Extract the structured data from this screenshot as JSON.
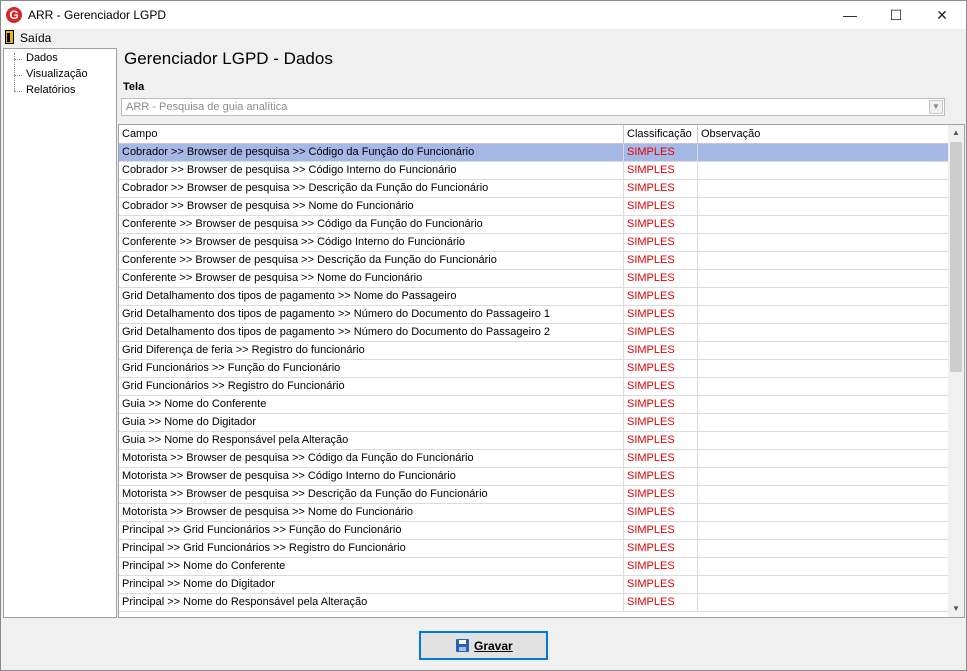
{
  "window": {
    "title": "ARR - Gerenciador LGPD",
    "icon_letter": "G",
    "controls": {
      "minimize": "—",
      "maximize": "☐",
      "close": "✕"
    }
  },
  "menu": {
    "exit_label": "Saída"
  },
  "tree": {
    "items": [
      "Dados",
      "Visualização",
      "Relatórios"
    ]
  },
  "page": {
    "title": "Gerenciador LGPD - Dados"
  },
  "tela": {
    "label": "Tela",
    "value": "ARR - Pesquisa de guia analítica"
  },
  "grid": {
    "columns": [
      "Campo",
      "Classificação",
      "Observação"
    ],
    "rows": [
      {
        "campo": "Cobrador >> Browser de pesquisa >> Código da Função do Funcionário",
        "classificacao": "SIMPLES",
        "observacao": ""
      },
      {
        "campo": "Cobrador >> Browser de pesquisa >> Código Interno do Funcionário",
        "classificacao": "SIMPLES",
        "observacao": ""
      },
      {
        "campo": "Cobrador >> Browser de pesquisa >> Descrição da Função do Funcionário",
        "classificacao": "SIMPLES",
        "observacao": ""
      },
      {
        "campo": "Cobrador >> Browser de pesquisa >> Nome do Funcionário",
        "classificacao": "SIMPLES",
        "observacao": ""
      },
      {
        "campo": "Conferente >> Browser de pesquisa >> Código da Função do Funcionário",
        "classificacao": "SIMPLES",
        "observacao": ""
      },
      {
        "campo": "Conferente >> Browser de pesquisa >> Código Interno do Funcionário",
        "classificacao": "SIMPLES",
        "observacao": ""
      },
      {
        "campo": "Conferente >> Browser de pesquisa >> Descrição da Função do Funcionário",
        "classificacao": "SIMPLES",
        "observacao": ""
      },
      {
        "campo": "Conferente >> Browser de pesquisa >> Nome do Funcionário",
        "classificacao": "SIMPLES",
        "observacao": ""
      },
      {
        "campo": "Grid Detalhamento dos tipos de pagamento >> Nome do Passageiro",
        "classificacao": "SIMPLES",
        "observacao": ""
      },
      {
        "campo": "Grid Detalhamento dos tipos de pagamento >> Número do Documento do Passageiro 1",
        "classificacao": "SIMPLES",
        "observacao": ""
      },
      {
        "campo": "Grid Detalhamento dos tipos de pagamento >> Número do Documento do Passageiro 2",
        "classificacao": "SIMPLES",
        "observacao": ""
      },
      {
        "campo": "Grid Diferença de feria >> Registro do funcionário",
        "classificacao": "SIMPLES",
        "observacao": ""
      },
      {
        "campo": "Grid Funcionários >> Função do Funcionário",
        "classificacao": "SIMPLES",
        "observacao": ""
      },
      {
        "campo": "Grid Funcionários >> Registro do Funcionário",
        "classificacao": "SIMPLES",
        "observacao": ""
      },
      {
        "campo": "Guia >> Nome do Conferente",
        "classificacao": "SIMPLES",
        "observacao": ""
      },
      {
        "campo": "Guia >> Nome do Digitador",
        "classificacao": "SIMPLES",
        "observacao": ""
      },
      {
        "campo": "Guia >> Nome do Responsável pela Alteração",
        "classificacao": "SIMPLES",
        "observacao": ""
      },
      {
        "campo": "Motorista >> Browser de pesquisa >> Código da Função do Funcionário",
        "classificacao": "SIMPLES",
        "observacao": ""
      },
      {
        "campo": "Motorista >> Browser de pesquisa >> Código Interno do Funcionário",
        "classificacao": "SIMPLES",
        "observacao": ""
      },
      {
        "campo": "Motorista >> Browser de pesquisa >> Descrição da Função do Funcionário",
        "classificacao": "SIMPLES",
        "observacao": ""
      },
      {
        "campo": "Motorista >> Browser de pesquisa >> Nome do Funcionário",
        "classificacao": "SIMPLES",
        "observacao": ""
      },
      {
        "campo": "Principal >> Grid Funcionários >> Função do Funcionário",
        "classificacao": "SIMPLES",
        "observacao": ""
      },
      {
        "campo": "Principal >> Grid Funcionários >> Registro do Funcionário",
        "classificacao": "SIMPLES",
        "observacao": ""
      },
      {
        "campo": "Principal >> Nome do Conferente",
        "classificacao": "SIMPLES",
        "observacao": ""
      },
      {
        "campo": "Principal >> Nome do Digitador",
        "classificacao": "SIMPLES",
        "observacao": ""
      },
      {
        "campo": "Principal >> Nome do Responsável pela Alteração",
        "classificacao": "SIMPLES",
        "observacao": ""
      }
    ],
    "selected_row": 0
  },
  "actions": {
    "save_label": "Gravar"
  },
  "colors": {
    "selection": "#a6b8e6",
    "classification_text": "#e00000",
    "button_focus": "#0078d7"
  }
}
